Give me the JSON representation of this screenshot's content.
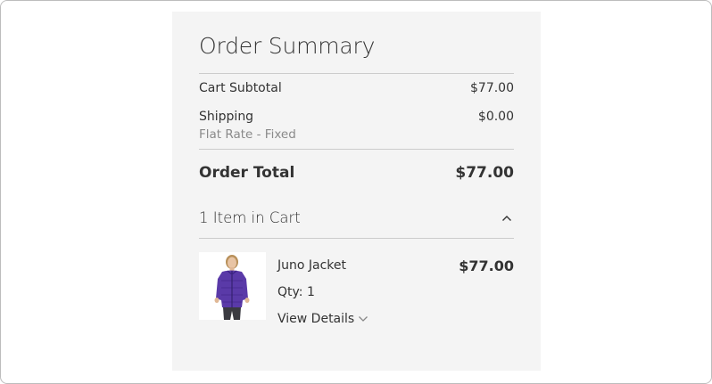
{
  "order_summary": {
    "title": "Order Summary",
    "cart_subtotal": {
      "label": "Cart Subtotal",
      "value": "$77.00"
    },
    "shipping": {
      "label": "Shipping",
      "method": "Flat Rate - Fixed",
      "value": "$0.00"
    },
    "order_total": {
      "label": "Order Total",
      "value": "$77.00"
    },
    "cart": {
      "count_label": "1 Item in Cart",
      "toggle_icon": "chevron-up-icon",
      "items": [
        {
          "name": "Juno Jacket",
          "price": "$77.00",
          "qty_label": "Qty: 1",
          "view_details_label": "View Details",
          "details_icon": "chevron-down-icon"
        }
      ]
    }
  },
  "colors": {
    "panel_background": "#f4f4f4",
    "divider": "#cccccc",
    "text": "#333333",
    "muted_text": "#8a8a8a",
    "product_jacket": "#5a3aa8"
  }
}
